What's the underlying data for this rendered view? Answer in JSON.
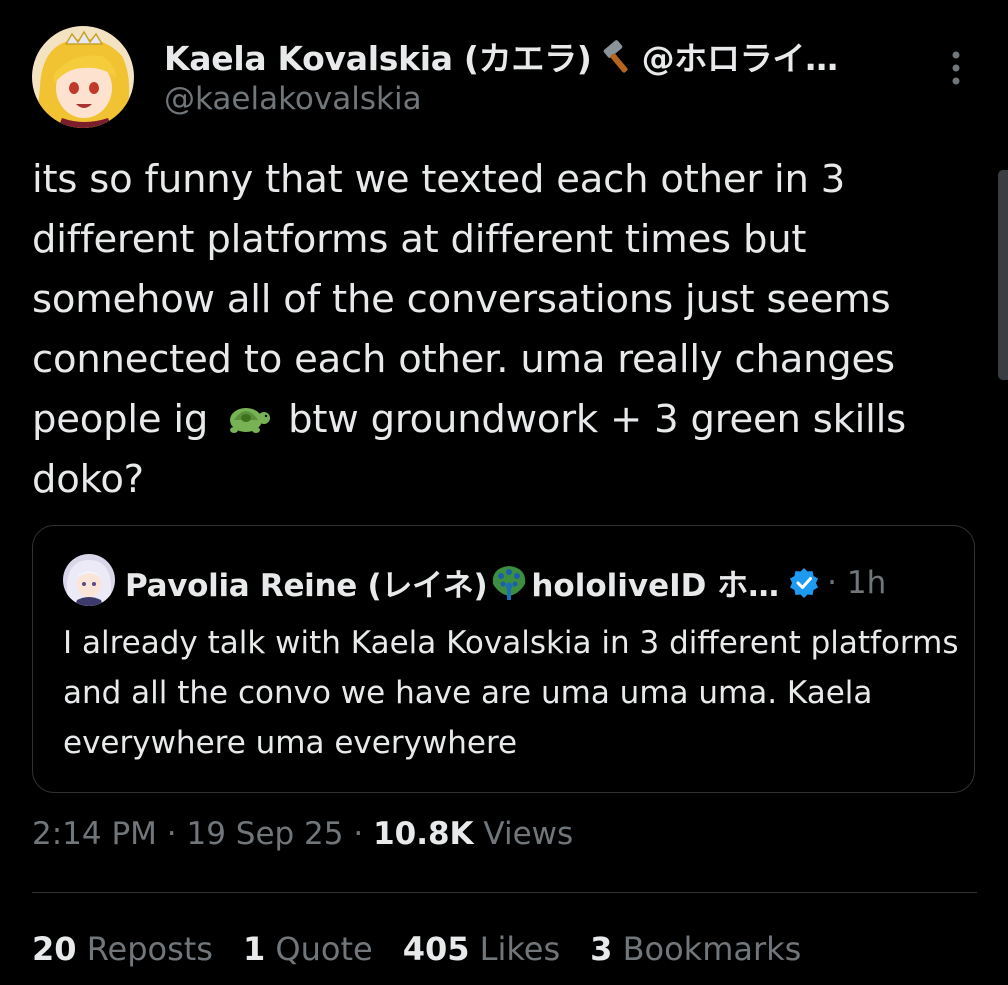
{
  "author": {
    "name": "Kaela Kovalskia (カエラ)",
    "name_suffix": "@ホロライ…",
    "handle": "@kaelakovalskia"
  },
  "tweet": {
    "text_part1": "its so funny that we texted each other in 3 different platforms at different times but somehow all of the conversations just seems connected to each other. uma really changes people ig",
    "text_part2": " btw groundwork + 3 green skills doko?"
  },
  "quote": {
    "name": "Pavolia Reine (レイネ)",
    "name_suffix": "hololiveID ホ…",
    "time": "· 1h",
    "text": "I already talk with Kaela Kovalskia in 3 different platforms and all the convo we have are uma uma uma. Kaela everywhere uma everywhere"
  },
  "meta": {
    "timestamp": "2:14 PM · 19 Sep 25 · ",
    "views_count": "10.8K",
    "views_label": " Views"
  },
  "stats": {
    "reposts_count": "20",
    "reposts_label": " Reposts",
    "quotes_count": "1",
    "quotes_label": " Quote",
    "likes_count": "405",
    "likes_label": " Likes",
    "bookmarks_count": "3",
    "bookmarks_label": " Bookmarks"
  },
  "colors": {
    "background": "#000000",
    "text_primary": "#e7e9ea",
    "text_secondary": "#71767b",
    "border": "#2f3336",
    "verified": "#1d9bf0"
  },
  "icons": {
    "more": "more-vertical-icon",
    "hammer": "hammer-icon",
    "turtle": "turtle-emoji-icon",
    "peacock": "peacock-emoji-icon",
    "verified": "verified-badge-icon"
  }
}
